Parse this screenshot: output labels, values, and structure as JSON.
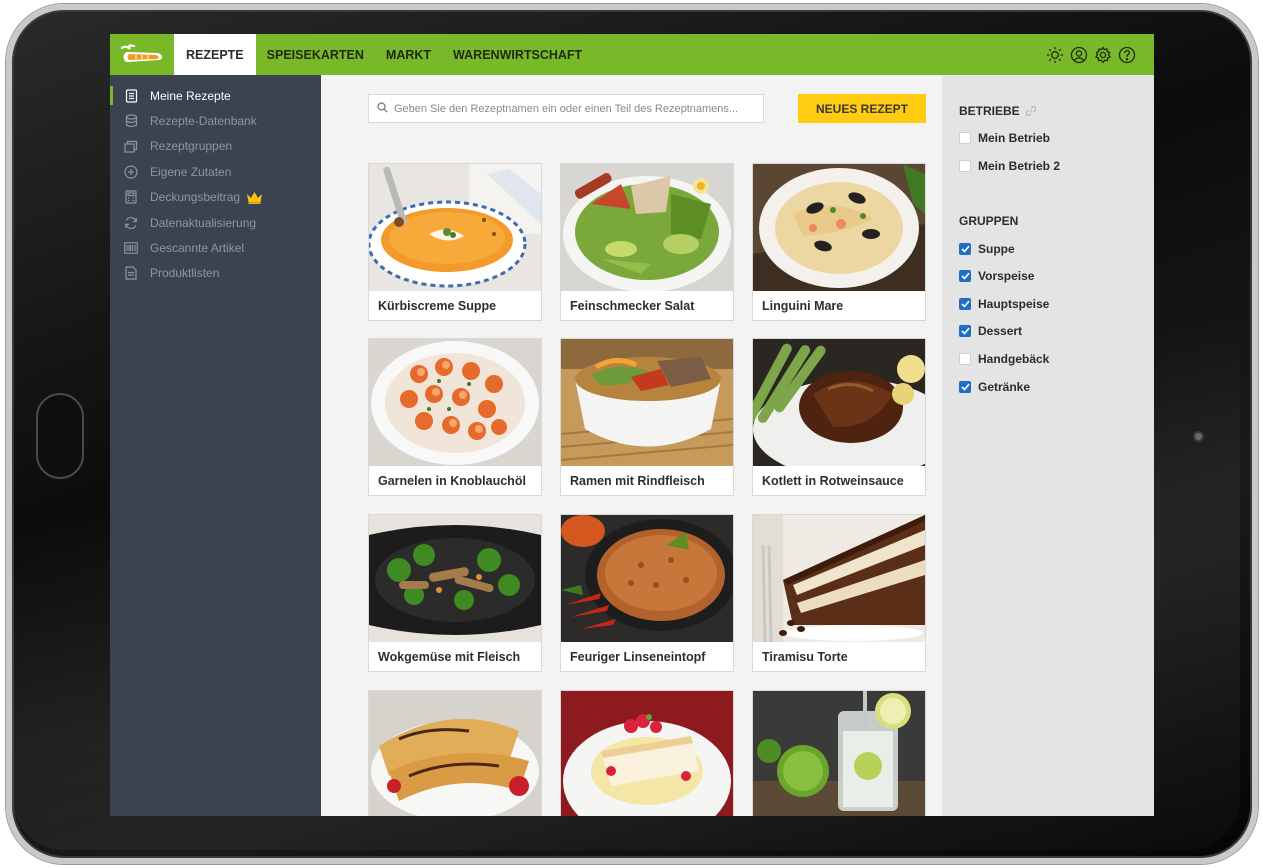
{
  "nav": {
    "tabs": [
      {
        "label": "REZEPTE",
        "active": true
      },
      {
        "label": "SPEISEKARTEN",
        "active": false
      },
      {
        "label": "MARKT",
        "active": false
      },
      {
        "label": "WARENWIRTSCHAFT",
        "active": false
      }
    ],
    "icons": [
      "sun-icon",
      "user-icon",
      "gear-icon",
      "help-icon"
    ]
  },
  "sidebar": {
    "items": [
      {
        "label": "Meine Rezepte",
        "icon": "document-icon",
        "active": true
      },
      {
        "label": "Rezepte-Datenbank",
        "icon": "database-icon",
        "active": false
      },
      {
        "label": "Rezeptgruppen",
        "icon": "folders-icon",
        "active": false
      },
      {
        "label": "Eigene Zutaten",
        "icon": "plus-circle-icon",
        "active": false
      },
      {
        "label": "Deckungsbeitrag",
        "icon": "calculator-icon",
        "active": false,
        "premium": true
      },
      {
        "label": "Datenaktualisierung",
        "icon": "refresh-icon",
        "active": false
      },
      {
        "label": "Gescannte Artikel",
        "icon": "barcode-icon",
        "active": false
      },
      {
        "label": "Produktlisten",
        "icon": "list-document-icon",
        "active": false
      }
    ]
  },
  "main": {
    "search_placeholder": "Geben Sie den Rezeptnamen ein oder einen Teil des Rezeptnamens...",
    "new_recipe_label": "NEUES REZEPT",
    "recipes": [
      {
        "title": "Kürbiscreme Suppe"
      },
      {
        "title": "Feinschmecker Salat"
      },
      {
        "title": "Linguini Mare"
      },
      {
        "title": "Garnelen in Knoblauchöl"
      },
      {
        "title": "Ramen mit Rindfleisch"
      },
      {
        "title": "Kotlett in Rotweinsauce"
      },
      {
        "title": "Wokgemüse mit Fleisch"
      },
      {
        "title": "Feuriger Linseneintopf"
      },
      {
        "title": "Tiramisu Torte"
      },
      {
        "title": ""
      },
      {
        "title": ""
      },
      {
        "title": ""
      }
    ]
  },
  "filters": {
    "betriebe_heading": "BETRIEBE",
    "betriebe": [
      {
        "label": "Mein Betrieb",
        "checked": false
      },
      {
        "label": "Mein Betrieb 2",
        "checked": false
      }
    ],
    "gruppen_heading": "GRUPPEN",
    "gruppen": [
      {
        "label": "Suppe",
        "checked": true
      },
      {
        "label": "Vorspeise",
        "checked": true
      },
      {
        "label": "Hauptspeise",
        "checked": true
      },
      {
        "label": "Dessert",
        "checked": true
      },
      {
        "label": "Handgebäck",
        "checked": false
      },
      {
        "label": "Getränke",
        "checked": true
      }
    ]
  },
  "colors": {
    "brand_green": "#79b829",
    "sidebar_bg": "#3b4350",
    "button_yellow": "#ffcc12",
    "checkbox_blue": "#1f6fc2"
  }
}
